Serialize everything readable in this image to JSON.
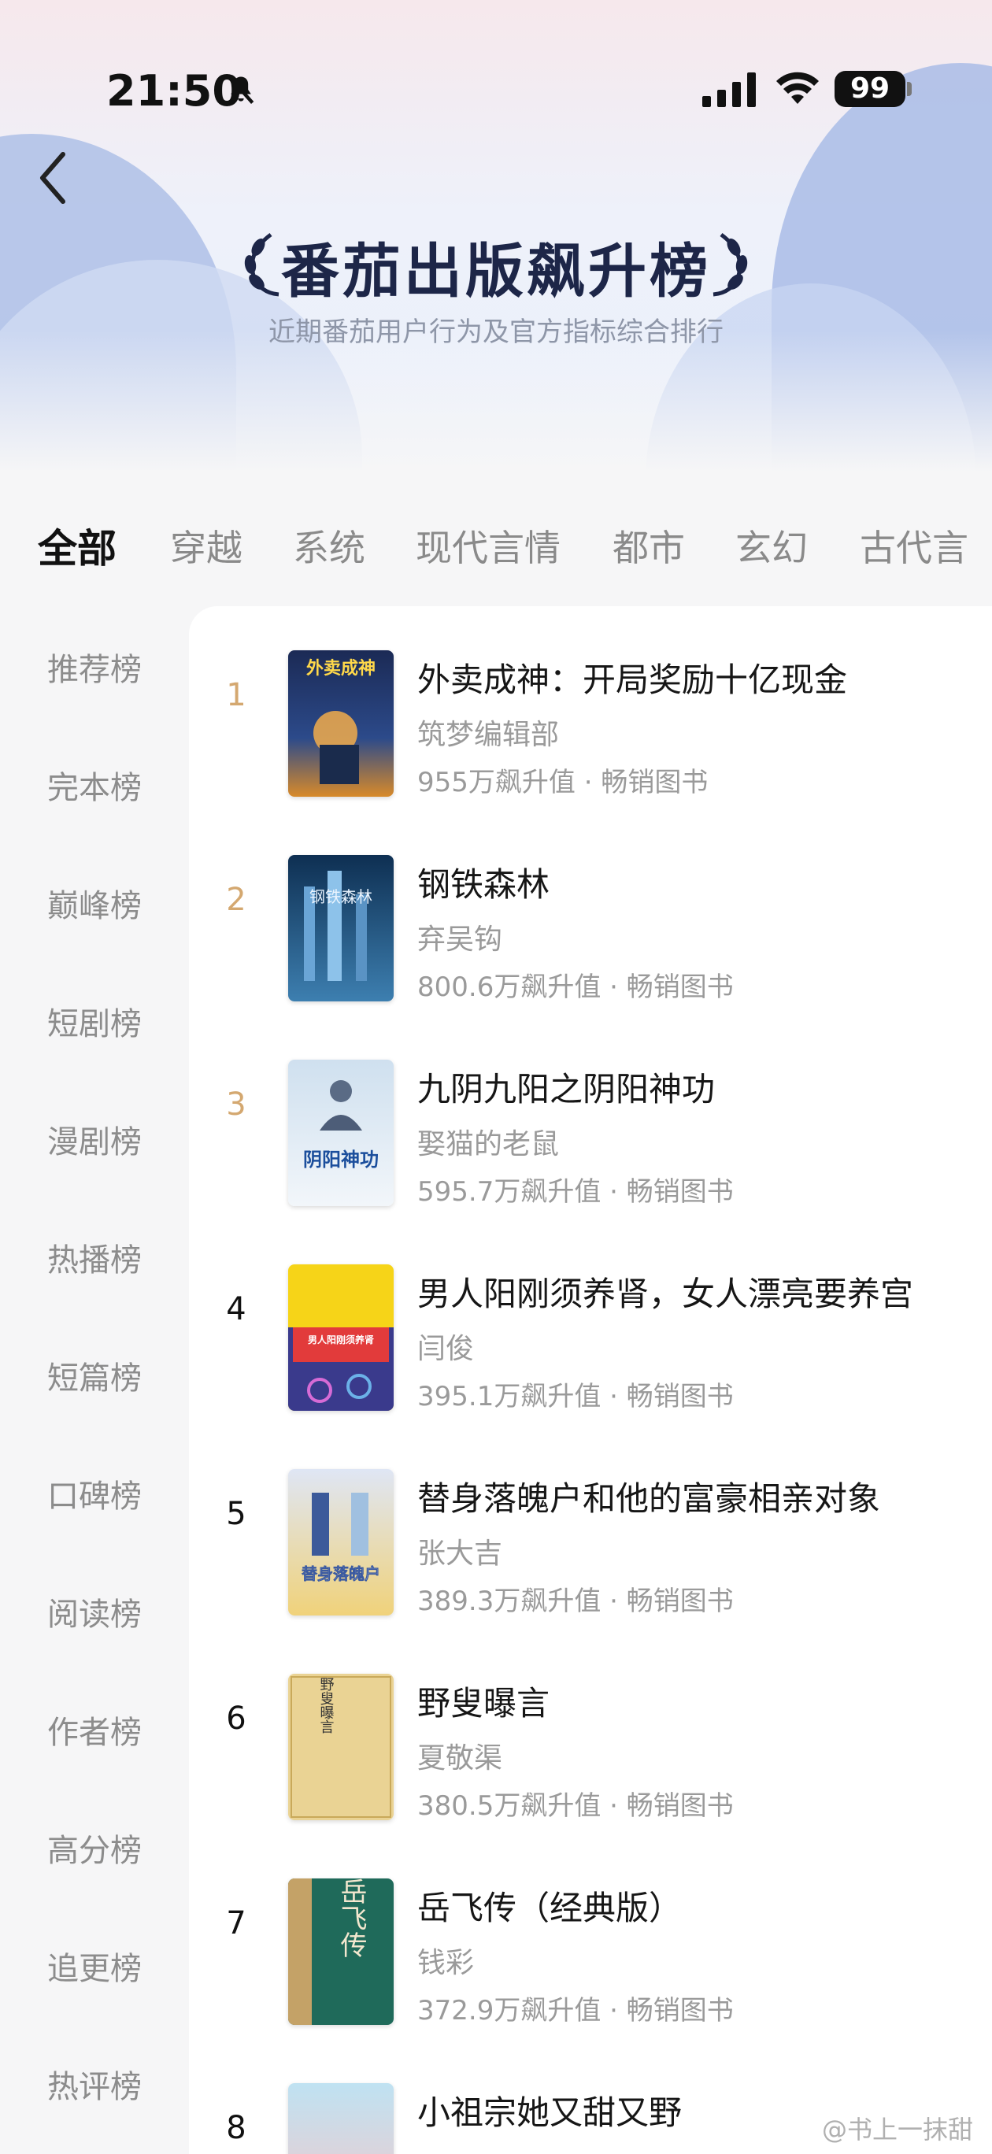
{
  "status_bar": {
    "time": "21:50",
    "battery": "99"
  },
  "header": {
    "title": "番茄出版飙升榜",
    "subtitle": "近期番茄用户行为及官方指标综合排行"
  },
  "tabs": [
    "全部",
    "穿越",
    "系统",
    "现代言情",
    "都市",
    "玄幻",
    "古代言"
  ],
  "active_tab": "全部",
  "sidebar": [
    "推荐榜",
    "完本榜",
    "巅峰榜",
    "短剧榜",
    "漫剧榜",
    "热播榜",
    "短篇榜",
    "口碑榜",
    "阅读榜",
    "作者榜",
    "高分榜",
    "追更榜",
    "热评榜"
  ],
  "books": [
    {
      "rank": "1",
      "title": "外卖成神：开局奖励十亿现金",
      "author": "筑梦编辑部",
      "meta": "955万飙升值 · 畅销图书",
      "cover_text": "外卖成神"
    },
    {
      "rank": "2",
      "title": "钢铁森林",
      "author": "弃吴钩",
      "meta": "800.6万飙升值 · 畅销图书",
      "cover_text": "钢铁森林"
    },
    {
      "rank": "3",
      "title": "九阴九阳之阴阳神功",
      "author": "娶猫的老鼠",
      "meta": "595.7万飙升值 · 畅销图书",
      "cover_text": "阴阳神功"
    },
    {
      "rank": "4",
      "title": "男人阳刚须养肾，女人漂亮要养宫",
      "author": "闫俊",
      "meta": "395.1万飙升值 · 畅销图书",
      "cover_text": "男人阳刚须养肾"
    },
    {
      "rank": "5",
      "title": "替身落魄户和他的富豪相亲对象",
      "author": "张大吉",
      "meta": "389.3万飙升值 · 畅销图书",
      "cover_text": "替身落魄户"
    },
    {
      "rank": "6",
      "title": "野叟曝言",
      "author": "夏敬渠",
      "meta": "380.5万飙升值 · 畅销图书",
      "cover_text": "野叟曝言"
    },
    {
      "rank": "7",
      "title": "岳飞传（经典版）",
      "author": "钱彩",
      "meta": "372.9万飙升值 · 畅销图书",
      "cover_text": "岳飞传"
    },
    {
      "rank": "8",
      "title": "小祖宗她又甜又野",
      "author": "",
      "meta": "",
      "cover_text": ""
    }
  ],
  "watermark": "@书上一抹甜"
}
